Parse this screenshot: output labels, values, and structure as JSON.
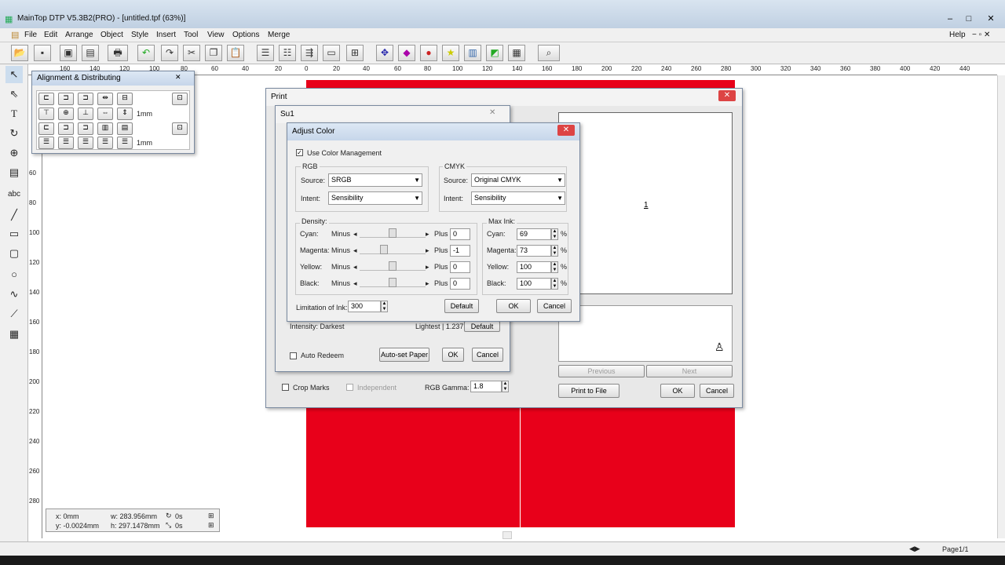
{
  "window": {
    "title": "MainTop DTP V5.3B2(PRO) - [untitled.tpf (63%)]",
    "min": "–",
    "max": "□",
    "close": "✕"
  },
  "menu": [
    "File",
    "Edit",
    "Arrange",
    "Object",
    "Style",
    "Insert",
    "Tool",
    "View",
    "Options",
    "Merge"
  ],
  "help": "Help",
  "toolbar_icons": [
    "open",
    "save",
    "print-setup",
    "print-preview",
    "print",
    "undo",
    "redo",
    "cut",
    "copy",
    "paste",
    "align-1",
    "align-2",
    "align-3",
    "align-4",
    "align-5",
    "move",
    "color-1",
    "color-2",
    "star",
    "chart",
    "shape",
    "image",
    "zoom"
  ],
  "ruler_top": [
    "160",
    "140",
    "120",
    "100",
    "80",
    "60",
    "40",
    "20",
    "0",
    "20",
    "40",
    "60",
    "80",
    "100",
    "120",
    "140",
    "160",
    "180",
    "200",
    "220",
    "240",
    "260",
    "280",
    "300",
    "320",
    "340",
    "360",
    "380",
    "400",
    "420",
    "440"
  ],
  "ruler_left": [
    "60",
    "80",
    "100",
    "120",
    "140",
    "160",
    "180",
    "200",
    "220",
    "240",
    "260",
    "280"
  ],
  "align_panel": {
    "title": "Alignment & Distributing",
    "value1": "1mm",
    "value2": "1mm"
  },
  "print": {
    "title": "Print",
    "page_number": "1",
    "previous": "Previous",
    "next": "Next",
    "print_to_file": "Print to File",
    "ok": "OK",
    "cancel": "Cancel",
    "crop_marks": "Crop Marks",
    "independent": "Independent",
    "rgb_gamma_label": "RGB Gamma:",
    "rgb_gamma": "1.8"
  },
  "sub": {
    "title": "Su1",
    "intensity": "Intensity: Darkest",
    "lightest": "Lightest | 1.237",
    "default": "Default",
    "auto_redeem": "Auto Redeem",
    "auto_set_paper": "Auto-set Paper",
    "ok": "OK",
    "cancel": "Cancel"
  },
  "adjust": {
    "title": "Adjust Color",
    "use_cm": "Use Color Management",
    "rgb": {
      "group": "RGB",
      "source_label": "Source:",
      "source": "SRGB",
      "intent_label": "Intent:",
      "intent": "Sensibility"
    },
    "cmyk": {
      "group": "CMYK",
      "source_label": "Source:",
      "source": "Original CMYK",
      "intent_label": "Intent:",
      "intent": "Sensibility"
    },
    "density": {
      "group": "Density:",
      "minus": "Minus",
      "plus": "Plus",
      "rows": [
        {
          "label": "Cyan:",
          "value": "0",
          "pos": 0.5
        },
        {
          "label": "Magenta:",
          "value": "-1",
          "pos": 0.35
        },
        {
          "label": "Yellow:",
          "value": "0",
          "pos": 0.5
        },
        {
          "label": "Black:",
          "value": "0",
          "pos": 0.5
        }
      ]
    },
    "maxink": {
      "group": "Max Ink:",
      "rows": [
        {
          "label": "Cyan:",
          "value": "69"
        },
        {
          "label": "Magenta:",
          "value": "73"
        },
        {
          "label": "Yellow:",
          "value": "100"
        },
        {
          "label": "Black:",
          "value": "100"
        }
      ],
      "unit": "%"
    },
    "limitation_label": "Limitation of Ink:",
    "limitation": "300",
    "default": "Default",
    "ok": "OK",
    "cancel": "Cancel"
  },
  "status": {
    "x": "x: 0mm",
    "y": "y: -0.0024mm",
    "w": "w: 283.956mm",
    "h": "h: 297.1478mm",
    "r1": "0s",
    "r2": "0s",
    "page": "Page1/1"
  }
}
